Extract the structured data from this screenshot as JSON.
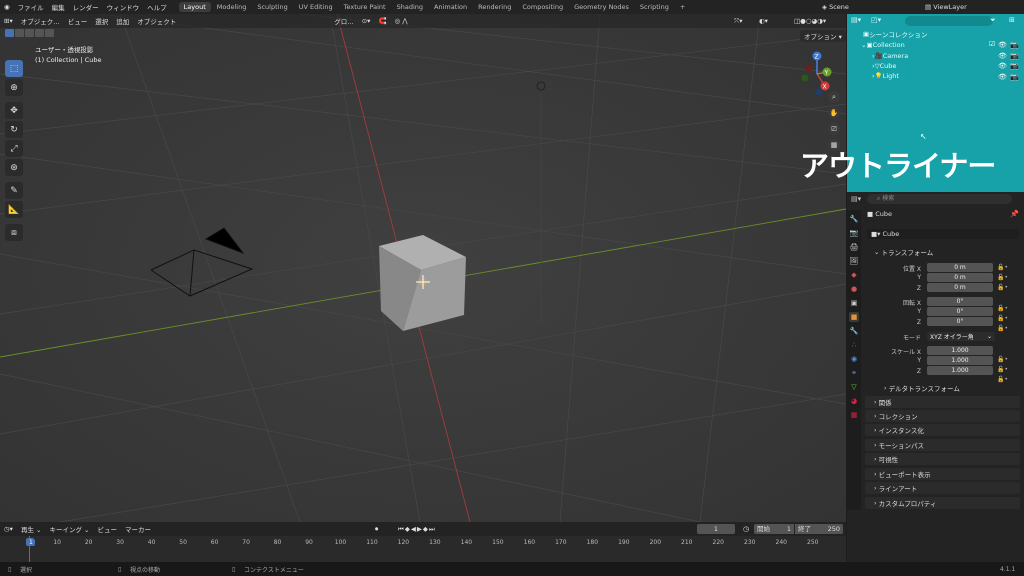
{
  "topbar": {
    "menus": [
      "ファイル",
      "編集",
      "レンダー",
      "ウィンドウ",
      "ヘルプ"
    ],
    "workspaces": [
      "Layout",
      "Modeling",
      "Sculpting",
      "UV Editing",
      "Texture Paint",
      "Shading",
      "Animation",
      "Rendering",
      "Compositing",
      "Geometry Nodes",
      "Scripting"
    ],
    "active_workspace": "Layout",
    "scene": "Scene",
    "view_layer": "ViewLayer"
  },
  "viewport": {
    "mode": "オブジェク…",
    "menus": [
      "ビュー",
      "選択",
      "追加",
      "オブジェクト"
    ],
    "transform_orient": "グロ…",
    "options": "オプション",
    "info_line1": "ユーザー・透視投影",
    "info_line2": "(1) Collection | Cube",
    "gizmo": {
      "x": "X",
      "y": "Y",
      "z": "Z"
    }
  },
  "outliner": {
    "scene_collection": "シーンコレクション",
    "collection": "Collection",
    "items": [
      "Camera",
      "Cube",
      "Light"
    ]
  },
  "overlay_caption": "アウトライナー",
  "properties": {
    "search_placeholder": "検索",
    "object_name": "Cube",
    "object_data_name": "Cube",
    "transform_header": "トランスフォーム",
    "location_label": "位置 X",
    "rotation_label": "回転 X",
    "scale_label": "スケール X",
    "axis_y": "Y",
    "axis_z": "Z",
    "location": [
      "0 m",
      "0 m",
      "0 m"
    ],
    "rotation": [
      "0°",
      "0°",
      "0°"
    ],
    "scale": [
      "1.000",
      "1.000",
      "1.000"
    ],
    "mode_label": "モード",
    "mode_value": "XYZ オイラー角",
    "delta_transform": "デルタトランスフォーム",
    "panels": [
      "関係",
      "コレクション",
      "インスタンス化",
      "モーションパス",
      "可視性",
      "ビューポート表示",
      "ラインアート",
      "カスタムプロパティ"
    ]
  },
  "timeline": {
    "playback": "再生",
    "keying": "キーイング",
    "view": "ビュー",
    "marker": "マーカー",
    "current_frame": "1",
    "start_label": "開始",
    "start": "1",
    "end_label": "終了",
    "end": "250",
    "ticks": [
      "1",
      "10",
      "20",
      "30",
      "40",
      "50",
      "60",
      "70",
      "80",
      "90",
      "100",
      "110",
      "120",
      "130",
      "140",
      "150",
      "160",
      "170",
      "180",
      "190",
      "200",
      "210",
      "220",
      "230",
      "240",
      "250"
    ]
  },
  "statusbar": {
    "select": "選択",
    "rotate_view": "視点の移動",
    "context_menu": "コンテクストメニュー",
    "version": "4.1.1"
  }
}
